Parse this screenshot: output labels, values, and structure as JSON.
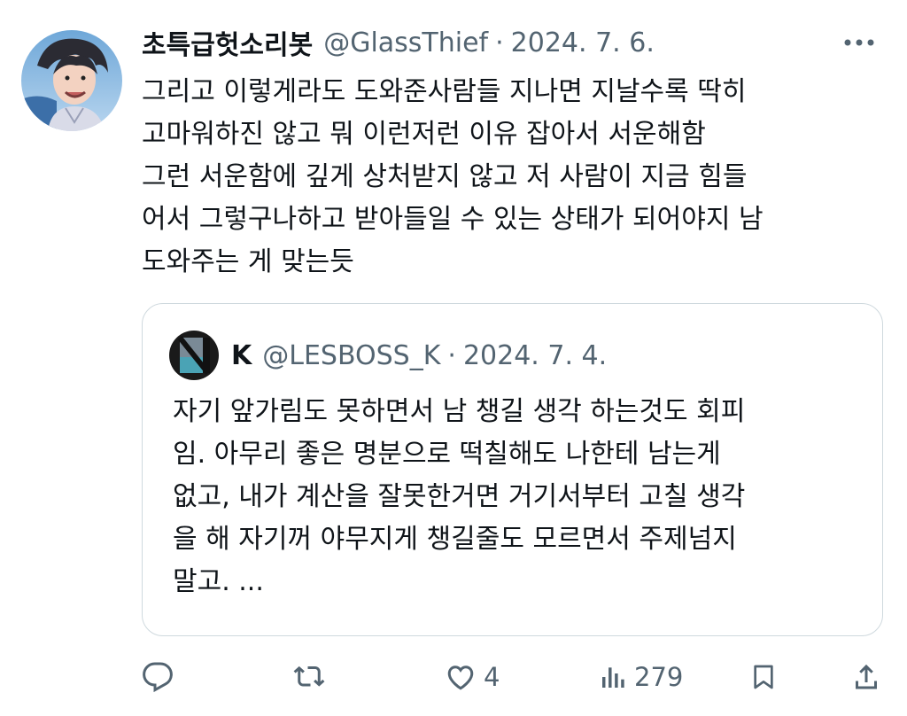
{
  "tweet": {
    "display_name": "초특급헛소리봇",
    "handle": "@GlassThief",
    "separator": "·",
    "date": "2024. 7. 6.",
    "text": "그리고 이렇게라도 도와준사람들 지나면 지날수록 딱히\n고마워하진 않고 뭐 이런저런 이유 잡아서 서운해함\n그런 서운함에 깊게 상처받지 않고 저 사람이 지금 힘들\n어서 그렇구나하고 받아들일 수 있는 상태가 되어야지 남\n도와주는 게 맞는듯"
  },
  "quote": {
    "display_name": "K",
    "handle": "@LESBOSS_K",
    "separator": "·",
    "date": "2024. 7. 4.",
    "text": "자기 앞가림도 못하면서 남 챙길 생각 하는것도 회피\n임. 아무리 좋은 명분으로 떡칠해도 나한테 남는게\n없고, 내가 계산을 잘못한거면 거기서부터 고칠 생각\n을 해 자기꺼 야무지게 챙길줄도 모르면서 주제넘지\n말고. ..."
  },
  "actions": {
    "reply_icon": "reply-icon",
    "retweet_icon": "retweet-icon",
    "like_icon": "heart-icon",
    "like_count": "4",
    "views_icon": "views-icon",
    "views_count": "279",
    "bookmark_icon": "bookmark-icon",
    "share_icon": "share-icon"
  },
  "colors": {
    "text": "#0f1419",
    "secondary": "#536471",
    "border": "#cfd9de"
  }
}
